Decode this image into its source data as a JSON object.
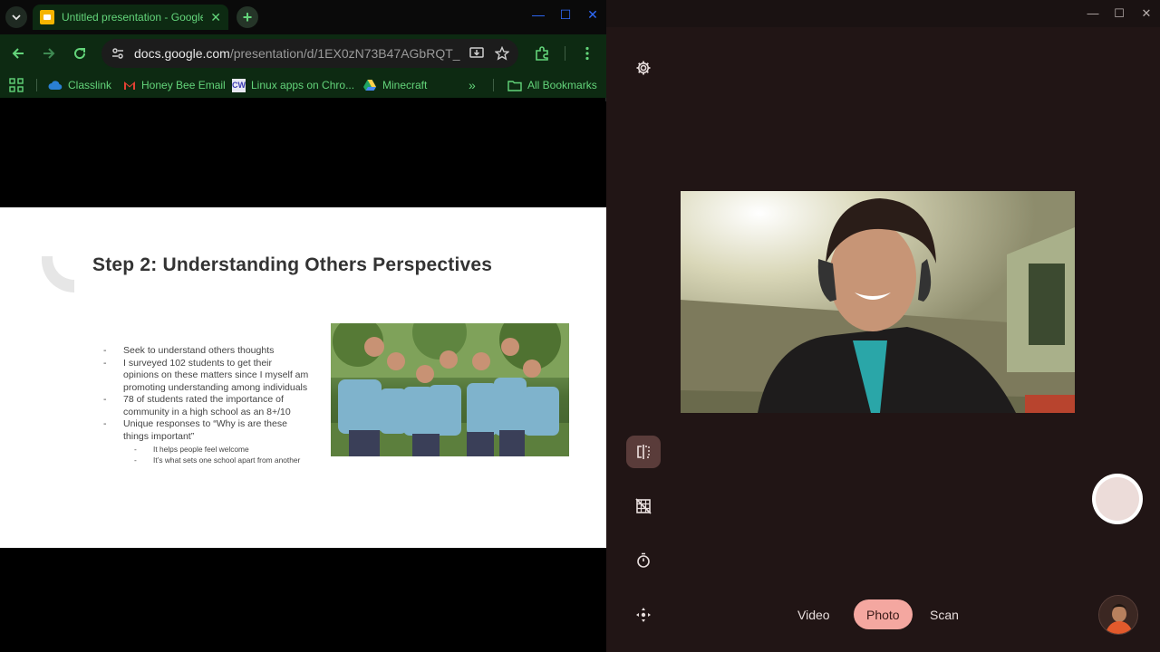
{
  "browser": {
    "tab_title": "Untitled presentation - Google Slides",
    "url_host": "docs.google.com",
    "url_path": "/presentation/d/1EX0zN73B47AGbRQT_...",
    "bookmarks": [
      {
        "label": "Classlink",
        "icon": "cloud-icon"
      },
      {
        "label": "Honey Bee Email",
        "icon": "gmail-icon"
      },
      {
        "label": "Linux apps on Chro...",
        "icon": "cw-icon"
      },
      {
        "label": "Minecraft",
        "icon": "drive-icon"
      }
    ],
    "all_bookmarks": "All Bookmarks",
    "overflow": "»",
    "colors": {
      "accent": "#63d47a",
      "toolbar": "#0d2a12",
      "window_controls": "#2f6bff"
    }
  },
  "slide": {
    "title": "Step 2: Understanding Others Perspectives",
    "bullets": [
      "Seek to understand others thoughts",
      "I surveyed 102 students to get their opinions on these matters since I myself am promoting understanding among individuals",
      "78 of students rated the importance of community in a high school as an 8+/10",
      "Unique responses to “Why is are these things important”"
    ],
    "sub_bullets": [
      "It helps people feel welcome",
      "It’s what sets one school apart from another"
    ]
  },
  "camera": {
    "modes": [
      "Video",
      "Photo",
      "Scan"
    ],
    "active_mode": "Photo",
    "colors": {
      "background": "#211515",
      "active_mode": "#f4a7a0",
      "mirror_button": "#5a3c3a"
    }
  }
}
